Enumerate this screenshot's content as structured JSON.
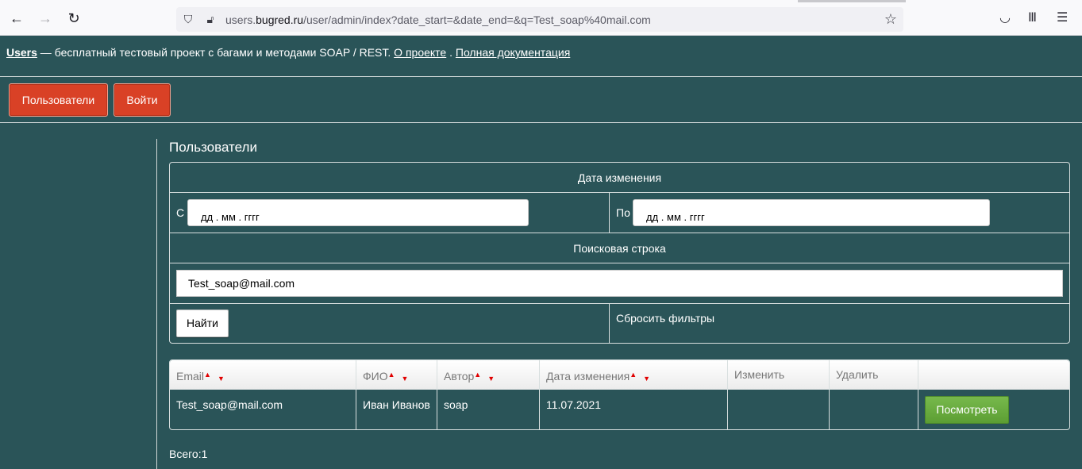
{
  "browser": {
    "url_prefix": "users.",
    "url_domain": "bugred.ru",
    "url_path": "/user/admin/index?date_start=&date_end=&q=Test_soap%40mail.com"
  },
  "header": {
    "brand": "Users",
    "tagline": " — бесплатный тестовый проект с багами и методами SOAP / REST. ",
    "about_link": "О проекте",
    "separator": " . ",
    "docs_link": "Полная документация"
  },
  "menu": {
    "users_button": "Пользователи",
    "login_button": "Войти"
  },
  "page": {
    "title": "Пользователи"
  },
  "filters": {
    "date_heading": "Дата изменения",
    "from_label": "С",
    "from_placeholder": "дд . мм . гггг",
    "to_label": "По",
    "to_placeholder": "дд . мм . гггг",
    "search_heading": "Поисковая строка",
    "search_value": "Test_soap@mail.com",
    "find_button": "Найти",
    "reset_link": "Сбросить фильтры"
  },
  "table": {
    "columns": [
      "Email",
      "ФИО",
      "Автор",
      "Дата изменения",
      "Изменить",
      "Удалить",
      ""
    ],
    "rows": [
      {
        "email": "Test_soap@mail.com",
        "name": "Иван Иванов",
        "author": "soap",
        "date": "11.07.2021",
        "edit": "",
        "delete": "",
        "view_button": "Посмотреть"
      }
    ]
  },
  "footer": {
    "total": "Всего:1"
  },
  "colors": {
    "page_bg": "#2a5458",
    "accent_button": "#d94126",
    "view_button": "#6aab3f"
  }
}
